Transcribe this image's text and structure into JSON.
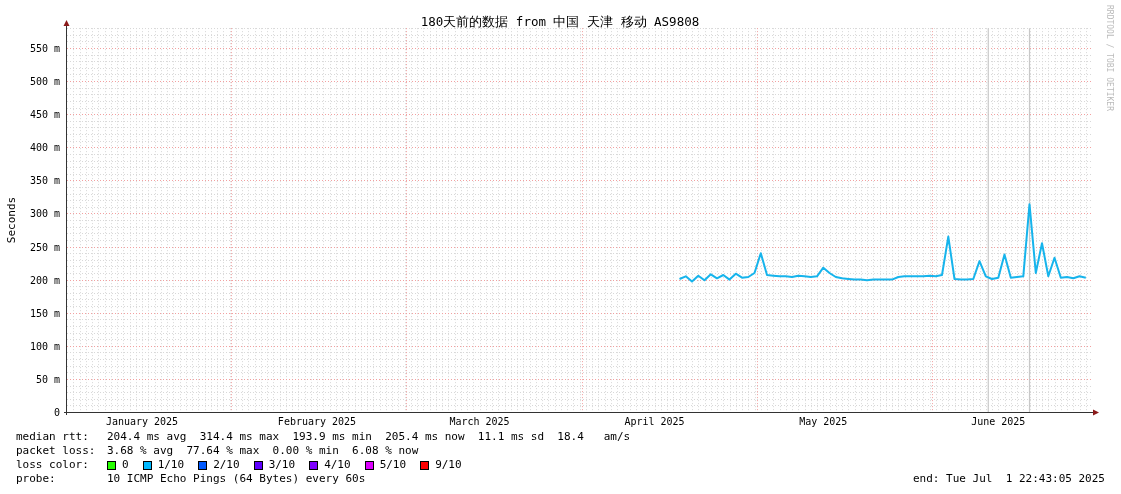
{
  "graph": {
    "credit": "RRDTOOL / TOBI OETIKER",
    "chart_data": {
      "type": "line",
      "title": "180天前的数据 from 中国 天津 移动 AS9808",
      "ylabel": "Seconds",
      "ylim": [
        0,
        580
      ],
      "grid": true,
      "categories": [
        null,
        null,
        null,
        null,
        null,
        null,
        null,
        null,
        null,
        null,
        null,
        null,
        "January 2025",
        null,
        null,
        null,
        null,
        null,
        null,
        null,
        null,
        null,
        null,
        null,
        null,
        null,
        null,
        null,
        null,
        null,
        null,
        null,
        null,
        null,
        null,
        null,
        null,
        null,
        null,
        null,
        "February 2025",
        null,
        null,
        null,
        null,
        null,
        null,
        null,
        null,
        null,
        null,
        null,
        null,
        null,
        null,
        null,
        null,
        null,
        null,
        null,
        null,
        null,
        null,
        null,
        null,
        null,
        "March 2025",
        null,
        null,
        null,
        null,
        null,
        null,
        null,
        null,
        null,
        null,
        null,
        null,
        null,
        null,
        null,
        null,
        null,
        null,
        null,
        null,
        null,
        null,
        null,
        null,
        null,
        null,
        null,
        "April 2025",
        null,
        null,
        null,
        null,
        null,
        null,
        null,
        null,
        null,
        null,
        null,
        null,
        null,
        null,
        null,
        null,
        null,
        null,
        null,
        null,
        null,
        null,
        null,
        null,
        null,
        null,
        "May 2025",
        null,
        null,
        null,
        null,
        null,
        null,
        null,
        null,
        null,
        null,
        null,
        null,
        null,
        null,
        null,
        null,
        null,
        null,
        null,
        null,
        null,
        null,
        null,
        null,
        null,
        null,
        null,
        "June 2025",
        null,
        null,
        null,
        null,
        null,
        null,
        null,
        null,
        null,
        null,
        null,
        null,
        null,
        null
      ],
      "yticks": [
        {
          "value": 0,
          "label": "0"
        },
        {
          "value": 50,
          "label": "50 m"
        },
        {
          "value": 100,
          "label": "100 m"
        },
        {
          "value": 150,
          "label": "150 m"
        },
        {
          "value": 200,
          "label": "200 m"
        },
        {
          "value": 250,
          "label": "250 m"
        },
        {
          "value": 300,
          "label": "300 m"
        },
        {
          "value": 350,
          "label": "350 m"
        },
        {
          "value": 400,
          "label": "400 m"
        },
        {
          "value": 450,
          "label": "450 m"
        },
        {
          "value": 500,
          "label": "500 m"
        },
        {
          "value": 550,
          "label": "550 m"
        }
      ],
      "series": [
        {
          "color": "#16b4ec",
          "values": [
            null,
            null,
            null,
            null,
            null,
            null,
            null,
            null,
            null,
            null,
            null,
            null,
            null,
            null,
            null,
            null,
            null,
            null,
            null,
            null,
            null,
            null,
            null,
            null,
            null,
            null,
            null,
            null,
            null,
            null,
            null,
            null,
            null,
            null,
            null,
            null,
            null,
            null,
            null,
            null,
            null,
            null,
            null,
            null,
            null,
            null,
            null,
            null,
            null,
            null,
            null,
            null,
            null,
            null,
            null,
            null,
            null,
            null,
            null,
            null,
            null,
            null,
            null,
            null,
            null,
            null,
            null,
            null,
            null,
            null,
            null,
            null,
            null,
            null,
            null,
            null,
            null,
            null,
            null,
            null,
            null,
            null,
            null,
            null,
            null,
            null,
            null,
            null,
            null,
            null,
            null,
            null,
            null,
            null,
            null,
            null,
            null,
            null,
            201,
            205,
            197,
            206,
            199,
            208,
            202,
            207,
            200,
            209,
            203,
            204,
            210,
            240,
            207,
            206,
            205,
            205,
            204,
            206,
            205,
            204,
            205,
            218,
            210,
            204,
            202,
            201,
            200,
            200,
            199,
            200,
            200,
            200,
            200,
            204,
            205,
            205,
            205,
            205,
            206,
            205,
            207,
            265,
            201,
            200,
            200,
            201,
            228,
            205,
            201,
            203,
            238,
            203,
            204,
            205,
            314,
            210,
            255,
            205,
            233,
            203,
            204,
            202,
            205,
            203
          ]
        }
      ]
    }
  },
  "legend": [
    {
      "kind": "text",
      "label": "median rtt:",
      "text": "204.4 ms avg  314.4 ms max  193.9 ms min  205.4 ms now  11.1 ms sd  18.4   am/s"
    },
    {
      "kind": "text",
      "label": "packet loss:",
      "text": "3.68 % avg  77.64 % max  0.00 % min  6.08 % now"
    },
    {
      "kind": "swatches",
      "label": "loss color:",
      "items": [
        {
          "label": "0",
          "color": "#26ff00"
        },
        {
          "label": "1/10",
          "color": "#00b8ff"
        },
        {
          "label": "2/10",
          "color": "#0059ff"
        },
        {
          "label": "3/10",
          "color": "#5e00ff"
        },
        {
          "label": "4/10",
          "color": "#7e00ff"
        },
        {
          "label": "5/10",
          "color": "#dd00ff"
        },
        {
          "label": "9/10",
          "color": "#ff0000"
        }
      ]
    },
    {
      "kind": "text",
      "label": "probe:",
      "text": "10 ICMP Echo Pings (64 Bytes) every 60s",
      "end": "end: Tue Jul  1 22:43:05 2025"
    }
  ]
}
